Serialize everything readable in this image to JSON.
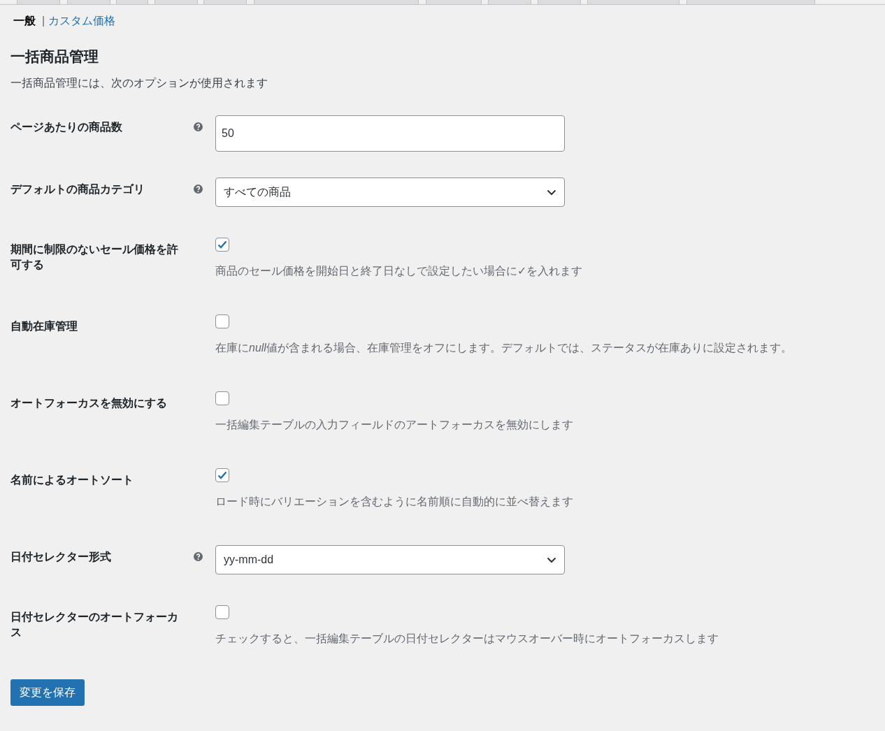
{
  "subnav": [
    {
      "label": "一般",
      "selected": true
    },
    {
      "label": "カスタム価格",
      "selected": false
    }
  ],
  "subnav_separator": "|",
  "heading": "一括商品管理",
  "intro": "一括商品管理には、次のオプションが使用されます",
  "settings": [
    {
      "kind": "text",
      "label": "ページあたりの商品数",
      "help": true,
      "value": "50"
    },
    {
      "kind": "select",
      "label": "デフォルトの商品カテゴリ",
      "help": true,
      "value": "すべての商品"
    },
    {
      "kind": "checkbox",
      "label": "期間に制限のないセール価格を許可する",
      "help": false,
      "checked": true,
      "description": "商品のセール価格を開始日と終了日なしで設定したい場合に✓を入れます"
    },
    {
      "kind": "checkbox",
      "label": "自動在庫管理",
      "help": false,
      "checked": false,
      "description": [
        {
          "text": "在庫に",
          "italic": false
        },
        {
          "text": "null",
          "italic": true
        },
        {
          "text": "値が含まれる場合、在庫管理をオフにします。デフォルトでは、ステータスが在庫ありに設定されます。",
          "italic": false
        }
      ]
    },
    {
      "kind": "checkbox",
      "label": "オートフォーカスを無効にする",
      "help": false,
      "checked": false,
      "description": "一括編集テーブルの入力フィールドのアートフォーカスを無効にします"
    },
    {
      "kind": "checkbox",
      "label": "名前によるオートソート",
      "help": false,
      "checked": true,
      "description": "ロード時にバリエーションを含むように名前順に自動的に並べ替えます"
    },
    {
      "kind": "select",
      "label": "日付セレクター形式",
      "help": true,
      "value": "yy-mm-dd"
    },
    {
      "kind": "checkbox",
      "label": "日付セレクターのオートフォーカス",
      "help": false,
      "checked": false,
      "description": "チェックすると、一括編集テーブルの日付セレクターはマウスオーバー時にオートフォーカスします"
    }
  ],
  "save_button": "変更を保存"
}
